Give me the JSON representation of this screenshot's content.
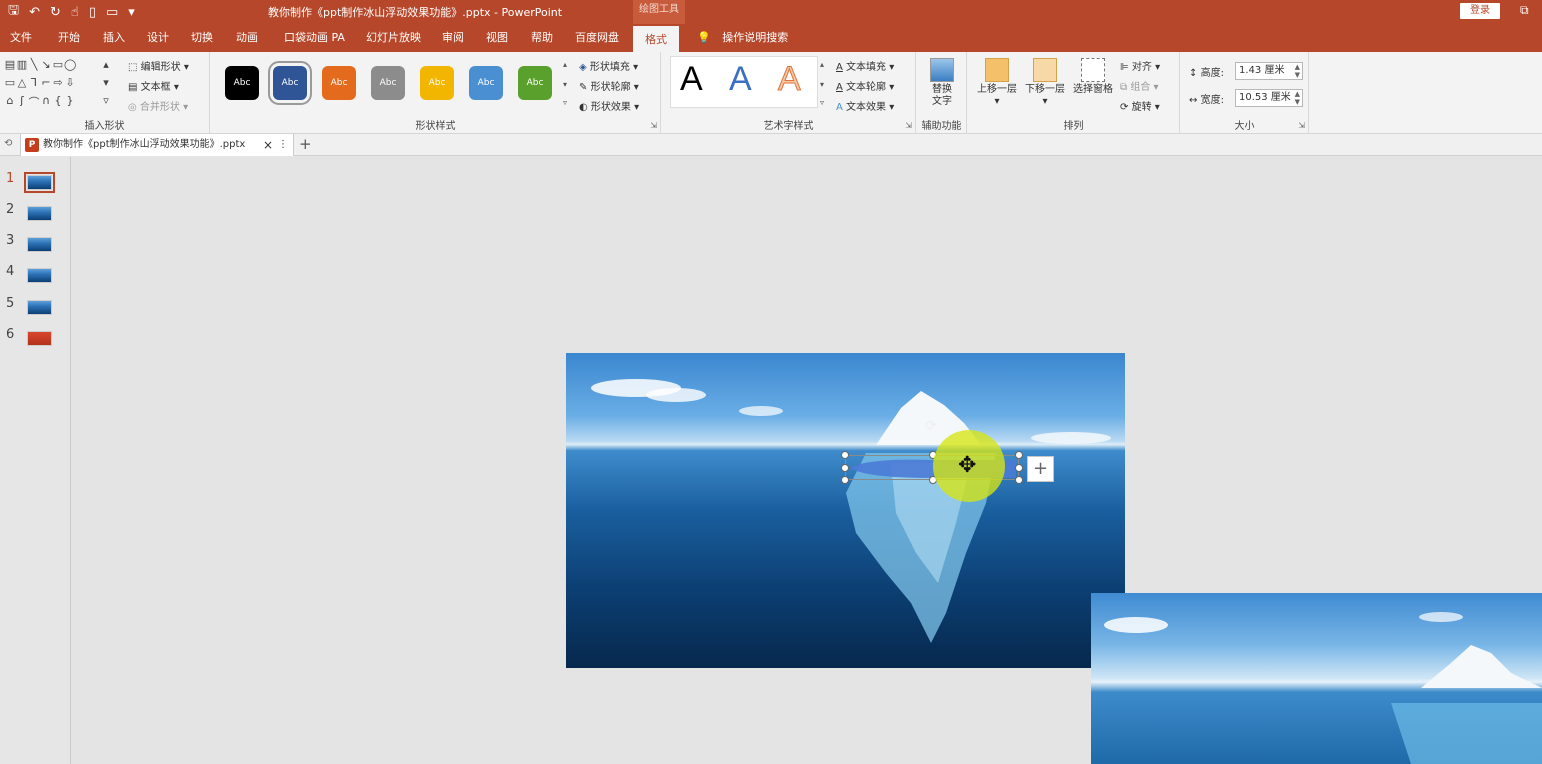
{
  "titlebar": {
    "title": "教你制作《ppt制作冰山浮动效果功能》.pptx  -  PowerPoint",
    "context_tool": "绘图工具",
    "login": "登录",
    "qat_icons": [
      "save-icon",
      "undo-icon",
      "redo-icon",
      "touch-icon",
      "new-icon",
      "open-icon",
      "customize-icon"
    ]
  },
  "tabs": [
    "文件",
    "开始",
    "插入",
    "设计",
    "切换",
    "动画",
    "口袋动画 PA",
    "幻灯片放映",
    "审阅",
    "视图",
    "帮助",
    "百度网盘",
    "格式"
  ],
  "tell_me": "操作说明搜索",
  "ribbon": {
    "insert_shapes": {
      "label": "插入形状",
      "edit_shape": "编辑形状",
      "text_box": "文本框",
      "merge_shapes": "合并形状"
    },
    "shape_styles": {
      "label": "形状样式",
      "thumb_text": "Abc",
      "colors": [
        "#000000",
        "#2f5597",
        "#e46b1e",
        "#8c8c8c",
        "#f2b600",
        "#4a8fd2",
        "#5aa02c"
      ],
      "fill": "形状填充",
      "outline": "形状轮廓",
      "effects": "形状效果"
    },
    "wordart": {
      "label": "艺术字样式",
      "letter": "A",
      "text_fill": "文本填充",
      "text_outline": "文本轮廓",
      "text_effects": "文本效果"
    },
    "accessibility": {
      "label": "辅助功能",
      "alt_text": "替换文字"
    },
    "arrange": {
      "label": "排列",
      "bring_forward": "上移一层",
      "send_backward": "下移一层",
      "selection_pane": "选择窗格",
      "align": "对齐",
      "group": "组合",
      "rotate": "旋转"
    },
    "size": {
      "label": "大小",
      "height_label": "高度:",
      "height_value": "1.43 厘米",
      "width_label": "宽度:",
      "width_value": "10.53 厘米"
    }
  },
  "doc_tab": {
    "name": "教你制作《ppt制作冰山浮动效果功能》.pptx",
    "close": "×"
  },
  "slides": [
    "1",
    "2",
    "3",
    "4",
    "5",
    "6"
  ],
  "accent": "#b7472a"
}
